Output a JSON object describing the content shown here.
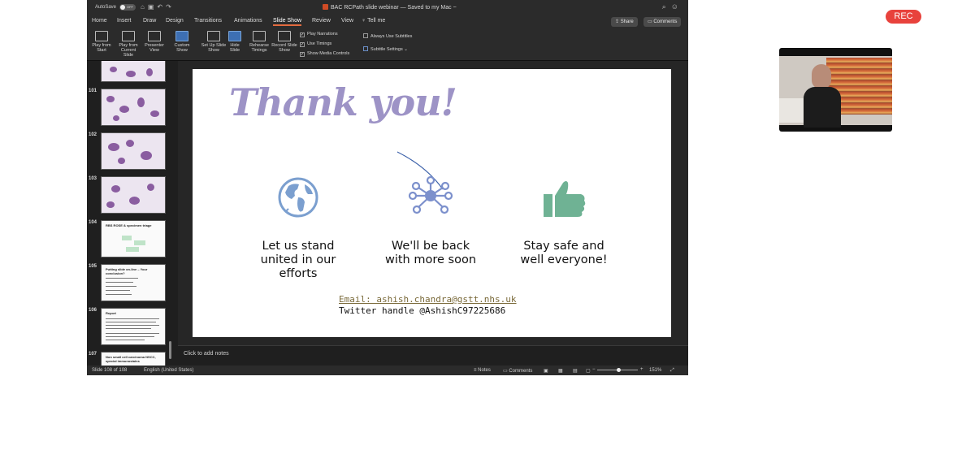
{
  "meeting": {
    "rec_label": "REC"
  },
  "window": {
    "autosave_label": "AutoSave",
    "autosave_state": "OFF",
    "document_title": "BAC RCPath slide webinar",
    "save_status": "— Saved to my Mac ~"
  },
  "tabs": [
    "Home",
    "Insert",
    "Draw",
    "Design",
    "Transitions",
    "Animations",
    "Slide Show",
    "Review",
    "View"
  ],
  "active_tab": "Slide Show",
  "tell_me": "Tell me",
  "share_label": "Share",
  "comments_label": "Comments",
  "ribbon": {
    "play_from_start": "Play from Start",
    "play_from_current": "Play from Current Slide",
    "presenter_view": "Presenter View",
    "custom_show": "Custom Show",
    "set_up": "Set Up Slide Show",
    "hide_slide": "Hide Slide",
    "rehearse": "Rehearse Timings",
    "record": "Record Slide Show",
    "play_narrations": "Play Narrations",
    "use_timings": "Use Timings",
    "show_media_controls": "Show Media Controls",
    "always_use_subtitles": "Always Use Subtitles",
    "subtitle_settings": "Subtitle Settings"
  },
  "thumbnails": {
    "numbers": [
      "101",
      "102",
      "103",
      "104",
      "105",
      "106",
      "107"
    ],
    "slide104_title": "RBS ROSE & specimen triage",
    "slide105_title": "Putting slide on-line – Your conclusion?",
    "slide106_title": "Report",
    "slide107_title": "Non small cell carcinoma NSCC, special immunostains"
  },
  "slide": {
    "title": "Thank you!",
    "col1": "Let us stand united in our efforts",
    "col2": "We'll be back with more soon",
    "col3": "Stay safe and well everyone!",
    "email": "Email: ashish.chandra@gstt.nhs.uk",
    "twitter": "Twitter handle @AshishC97225686"
  },
  "notes_placeholder": "Click to add notes",
  "status": {
    "slide_counter": "Slide 108 of 108",
    "language": "English (United States)",
    "notes": "Notes",
    "comments": "Comments",
    "zoom_percent": "151%"
  },
  "colors": {
    "title": "#9d93c6",
    "globe": "#7b9fcf",
    "network": "#7c90cc",
    "thumb": "#6fb294",
    "rec": "#e8423c",
    "tab_underline": "#e36b3f"
  }
}
